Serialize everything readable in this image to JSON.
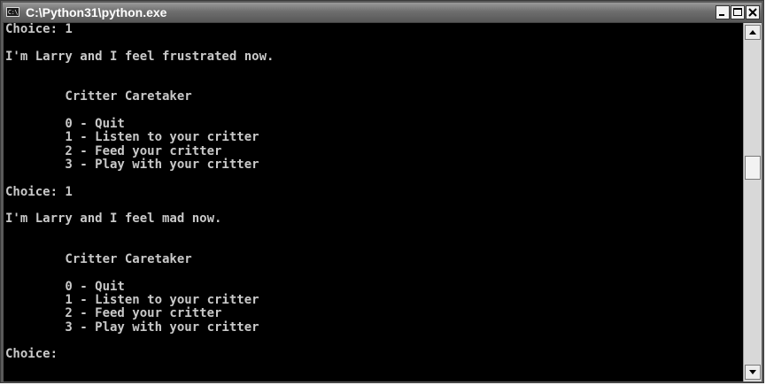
{
  "window": {
    "title": "C:\\Python31\\python.exe",
    "icon_text": "C:\\",
    "icon_name": "console-app-icon"
  },
  "console": {
    "lines": [
      "Choice: 1",
      "",
      "I'm Larry and I feel frustrated now.",
      "",
      "",
      "        Critter Caretaker",
      "",
      "        0 - Quit",
      "        1 - Listen to your critter",
      "        2 - Feed your critter",
      "        3 - Play with your critter",
      "",
      "Choice: 1",
      "",
      "I'm Larry and I feel mad now.",
      "",
      "",
      "        Critter Caretaker",
      "",
      "        0 - Quit",
      "        1 - Listen to your critter",
      "        2 - Feed your critter",
      "        3 - Play with your critter",
      "",
      "Choice: "
    ]
  },
  "controls": {
    "minimize_icon": "minimize-icon",
    "maximize_icon": "maximize-icon",
    "close_icon": "close-icon"
  },
  "scrollbar": {
    "position_fraction": 0.4
  }
}
